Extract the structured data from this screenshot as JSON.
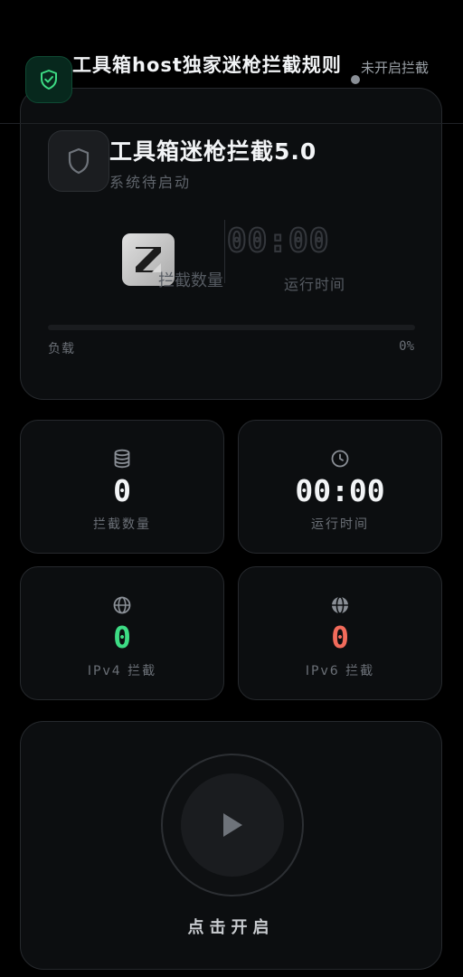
{
  "header": {
    "title": "工具箱host独家迷枪拦截规则",
    "status_text": "未开启拦截",
    "icon": "shield-check-icon"
  },
  "hero": {
    "title": "工具箱迷枪拦截5.0",
    "subtitle": "系统待启动",
    "count_label": "拦截数量",
    "time_value": "00:00",
    "time_label": "运行时间",
    "load_label": "负载",
    "load_value": "0%",
    "load_fraction": 0,
    "icon": "shield-outline-icon",
    "logo": "z-logo-icon"
  },
  "stats": [
    {
      "icon": "database-icon",
      "value": "0",
      "label": "拦截数量",
      "color": "#f2f4f6"
    },
    {
      "icon": "clock-icon",
      "value": "00:00",
      "label": "运行时间",
      "color": "#f2f4f6"
    },
    {
      "icon": "globe-icon",
      "value": "0",
      "label": "IPv4 拦截",
      "color": "#3ddc84"
    },
    {
      "icon": "globe-filled-icon",
      "value": "0",
      "label": "IPv6 拦截",
      "color": "#f26b5b"
    }
  ],
  "start": {
    "icon": "play-icon",
    "label": "点击开启"
  },
  "colors": {
    "accent_green": "#3ddc84",
    "accent_red": "#f26b5b",
    "background": "#000000",
    "card": "#0c0e10"
  }
}
